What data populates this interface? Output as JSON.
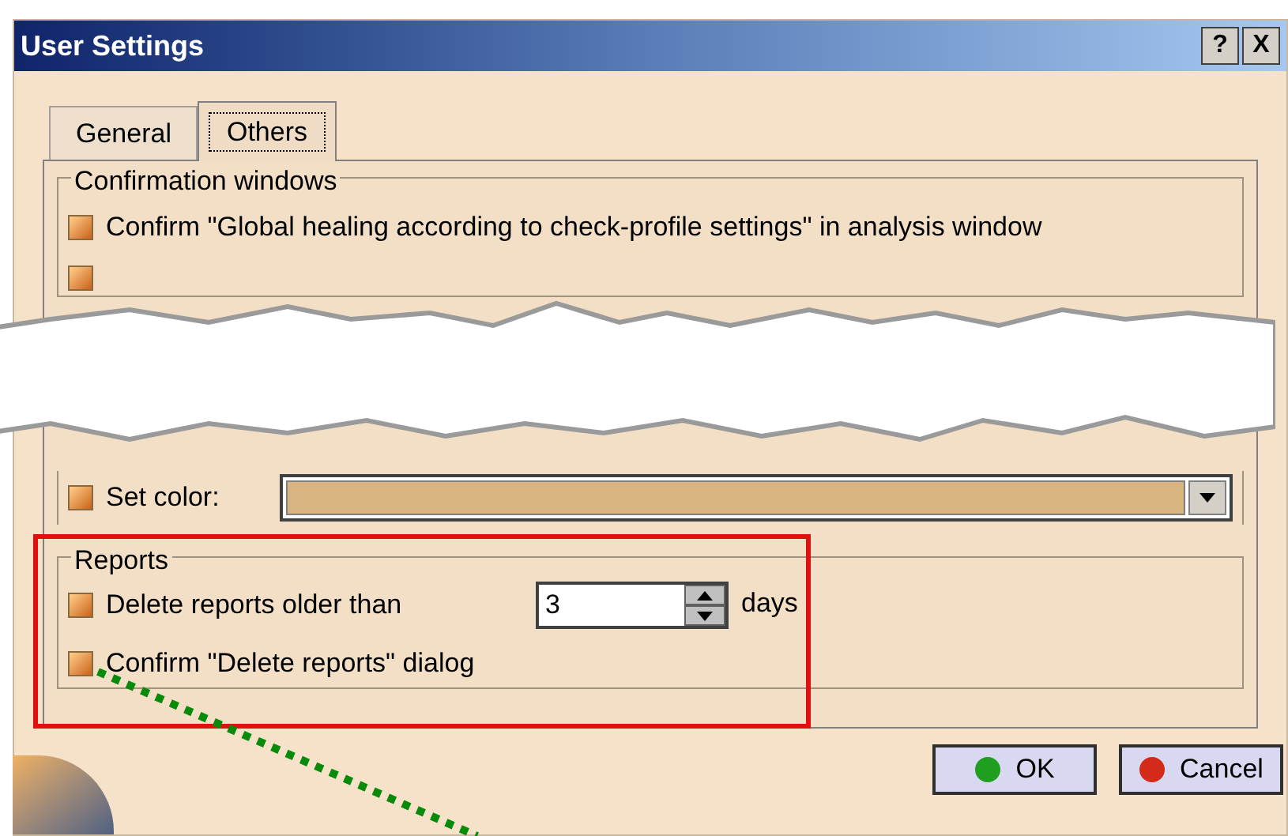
{
  "window": {
    "title": "User Settings",
    "help": "?",
    "close": "X"
  },
  "tabs": [
    {
      "label": "General",
      "selected": false
    },
    {
      "label": "Others",
      "selected": true
    }
  ],
  "confirmation_windows": {
    "title": "Confirmation windows",
    "options": [
      {
        "label": "Confirm \"Global healing according to check-profile settings\" in analysis window",
        "checked": true
      },
      {
        "checked": true
      }
    ]
  },
  "set_color": {
    "label": "Set color:",
    "checked": true
  },
  "reports": {
    "title": "Reports",
    "delete_older": {
      "label": "Delete reports older than",
      "checked": true,
      "value": "3",
      "unit": "days"
    },
    "confirm_delete": {
      "label": "Confirm \"Delete reports\" dialog",
      "checked": true
    }
  },
  "buttons": [
    {
      "label": "OK",
      "color": "#1f9e1f"
    },
    {
      "label": "Cancel",
      "color": "#d42a1a"
    }
  ]
}
